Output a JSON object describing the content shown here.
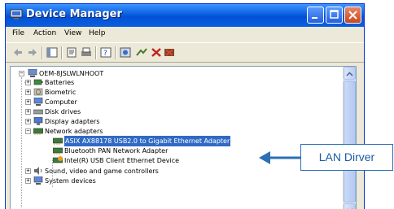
{
  "window": {
    "title": "Device Manager"
  },
  "menubar": {
    "items": [
      {
        "label": "File"
      },
      {
        "label": "Action"
      },
      {
        "label": "View"
      },
      {
        "label": "Help"
      }
    ]
  },
  "toolbar": {
    "icons": [
      "back-arrow-icon",
      "forward-arrow-icon",
      "console-tree-icon",
      "properties-icon",
      "print-icon",
      "help-icon",
      "scan-hardware-icon",
      "update-driver-icon",
      "disable-device-icon",
      "uninstall-device-icon"
    ]
  },
  "tree": {
    "root": "OEM-8JSLWLNHOOT",
    "items": [
      {
        "label": "Batteries"
      },
      {
        "label": "Biometric"
      },
      {
        "label": "Computer"
      },
      {
        "label": "Disk drives"
      },
      {
        "label": "Display adapters"
      },
      {
        "label": "Network adapters"
      },
      {
        "label": "ASIX AX88178 USB2.0 to Gigabit Ethernet Adapter"
      },
      {
        "label": "Bluetooth PAN Network Adapter"
      },
      {
        "label": "Intel(R) USB Client Ethernet Device"
      },
      {
        "label": "Sound, video and game controllers"
      },
      {
        "label": "System devices"
      }
    ]
  },
  "callout": {
    "label": "LAN Dirver"
  },
  "colors": {
    "titlebar": "#0a5fe0",
    "selection": "#316ac5",
    "callout_border": "#2c6fb5",
    "callout_text": "#1d5a9e"
  }
}
